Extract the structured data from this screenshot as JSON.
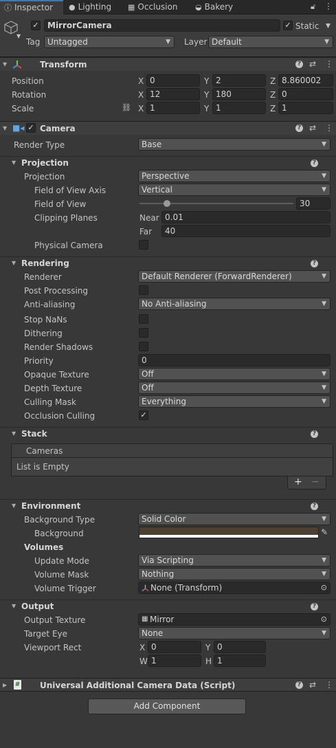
{
  "tabs": {
    "inspector": "Inspector",
    "lighting": "Lighting",
    "occlusion": "Occlusion",
    "bakery": "Bakery"
  },
  "object": {
    "name": "MirrorCamera",
    "static_label": "Static",
    "static_checked": true,
    "tag_label": "Tag",
    "tag_value": "Untagged",
    "layer_label": "Layer",
    "layer_value": "Default"
  },
  "transform": {
    "title": "Transform",
    "position_label": "Position",
    "position": {
      "x": "0",
      "y": "2",
      "z": "8.860002"
    },
    "rotation_label": "Rotation",
    "rotation": {
      "x": "12",
      "y": "180",
      "z": "0"
    },
    "scale_label": "Scale",
    "scale": {
      "x": "1",
      "y": "1",
      "z": "1"
    },
    "axis": {
      "x": "X",
      "y": "Y",
      "z": "Z",
      "w": "W",
      "h": "H"
    }
  },
  "camera": {
    "title": "Camera",
    "render_type_label": "Render Type",
    "render_type": "Base",
    "projection": {
      "title": "Projection",
      "projection_label": "Projection",
      "projection_value": "Perspective",
      "fov_axis_label": "Field of View Axis",
      "fov_axis_value": "Vertical",
      "fov_label": "Field of View",
      "fov_value": "30",
      "fov_slider_fraction": 0.179,
      "clip_label": "Clipping Planes",
      "near_label": "Near",
      "near_value": "0.01",
      "far_label": "Far",
      "far_value": "40",
      "physical_label": "Physical Camera"
    },
    "rendering": {
      "title": "Rendering",
      "renderer_label": "Renderer",
      "renderer_value": "Default Renderer (ForwardRenderer)",
      "post_label": "Post Processing",
      "aa_label": "Anti-aliasing",
      "aa_value": "No Anti-aliasing",
      "stopnans_label": "Stop NaNs",
      "dither_label": "Dithering",
      "shadows_label": "Render Shadows",
      "priority_label": "Priority",
      "priority_value": "0",
      "opaque_label": "Opaque Texture",
      "opaque_value": "Off",
      "depth_label": "Depth Texture",
      "depth_value": "Off",
      "culling_label": "Culling Mask",
      "culling_value": "Everything",
      "occlusion_label": "Occlusion Culling",
      "occlusion_checked": true
    },
    "stack": {
      "title": "Stack",
      "cameras_label": "Cameras",
      "empty_label": "List is Empty",
      "add_symbol": "+",
      "remove_symbol": "−"
    },
    "environment": {
      "title": "Environment",
      "bg_type_label": "Background Type",
      "bg_type_value": "Solid Color",
      "bg_label": "Background",
      "bg_color": "#4d4033",
      "volumes_label": "Volumes",
      "update_label": "Update Mode",
      "update_value": "Via Scripting",
      "mask_label": "Volume Mask",
      "mask_value": "Nothing",
      "trigger_label": "Volume Trigger",
      "trigger_value": "None (Transform)"
    },
    "output": {
      "title": "Output",
      "texture_label": "Output Texture",
      "texture_value": "Mirror",
      "eye_label": "Target Eye",
      "eye_value": "None",
      "viewport_label": "Viewport Rect",
      "vx": "0",
      "vy": "0",
      "vw": "1",
      "vh": "1"
    }
  },
  "script": {
    "title": "Universal Additional Camera Data (Script)"
  },
  "add_component": "Add Component",
  "colors": {
    "accent": "#3a79bb",
    "panel": "#383838",
    "header": "#3e3e3e"
  }
}
